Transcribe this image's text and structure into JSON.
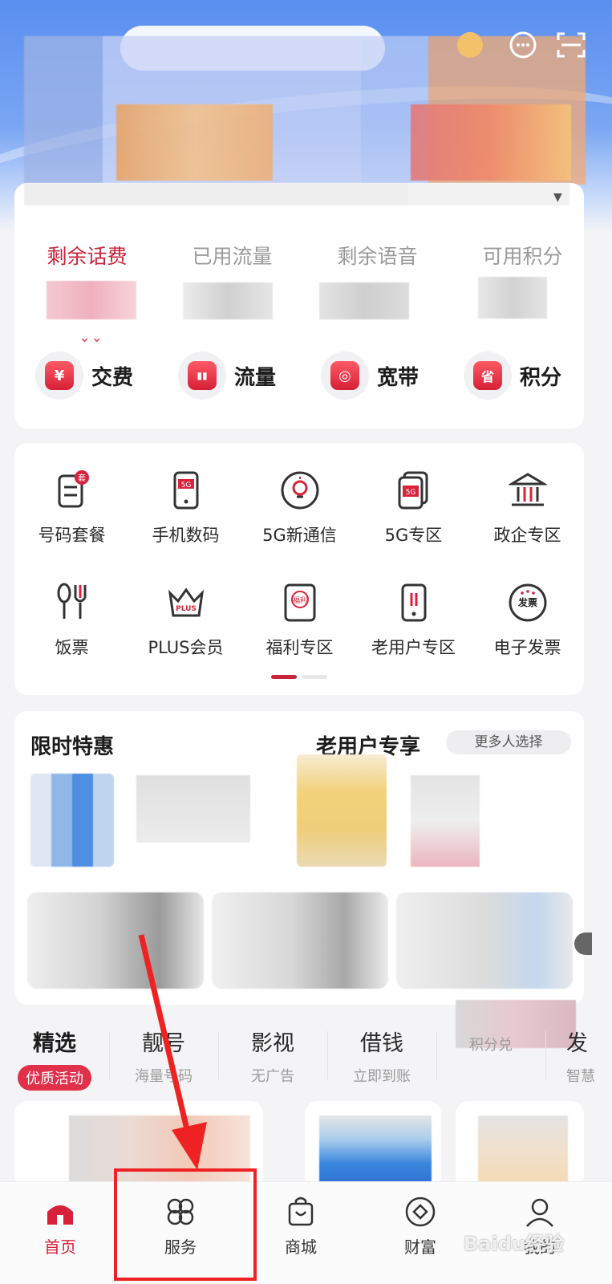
{
  "balance_tabs": [
    {
      "label": "剩余话费",
      "active": true
    },
    {
      "label": "已用流量",
      "active": false
    },
    {
      "label": "剩余语音",
      "active": false
    },
    {
      "label": "可用积分",
      "active": false
    }
  ],
  "quick_actions": [
    {
      "label": "交费",
      "icon": "yuan-icon",
      "glyph": "¥"
    },
    {
      "label": "流量",
      "icon": "bar-chart-icon",
      "glyph": "▮▮"
    },
    {
      "label": "宽带",
      "icon": "router-icon",
      "glyph": "◎"
    },
    {
      "label": "积分",
      "icon": "coupon-icon",
      "glyph": "省"
    }
  ],
  "service_grid": [
    {
      "label": "号码套餐",
      "icon": "sim-plan-icon",
      "badge": "套"
    },
    {
      "label": "手机数码",
      "icon": "phone-5g-icon",
      "badge": "5G"
    },
    {
      "label": "5G新通信",
      "icon": "lightbulb-icon"
    },
    {
      "label": "5G专区",
      "icon": "5g-cards-icon",
      "badge": "5G"
    },
    {
      "label": "政企专区",
      "icon": "building-icon"
    },
    {
      "label": "饭票",
      "icon": "spoon-fork-icon"
    },
    {
      "label": "PLUS会员",
      "icon": "crown-icon",
      "badge": "PLUS"
    },
    {
      "label": "福利专区",
      "icon": "gift-card-icon",
      "badge": "福利"
    },
    {
      "label": "老用户专区",
      "icon": "phone-transfer-icon"
    },
    {
      "label": "电子发票",
      "icon": "invoice-icon",
      "badge": "发票"
    }
  ],
  "promo": {
    "limited_title": "限时特惠",
    "old_user_title": "老用户专享",
    "more_choice": "更多人选择"
  },
  "categories": [
    {
      "title": "精选",
      "sub": "优质活动"
    },
    {
      "title": "靓号",
      "sub": "海量号码"
    },
    {
      "title": "影视",
      "sub": "无广告"
    },
    {
      "title": "借钱",
      "sub": "立即到账"
    },
    {
      "title": "",
      "sub": "积分兑"
    },
    {
      "title": "发",
      "sub": "智慧"
    }
  ],
  "bottom_nav": [
    {
      "label": "首页",
      "icon": "home-icon",
      "active": true
    },
    {
      "label": "服务",
      "icon": "four-petal-icon",
      "active": false
    },
    {
      "label": "商城",
      "icon": "shopping-bag-icon",
      "active": false
    },
    {
      "label": "财富",
      "icon": "diamond-icon",
      "active": false
    },
    {
      "label": "我的",
      "icon": "person-icon",
      "active": false
    }
  ],
  "colors": {
    "accent": "#c8233a",
    "highlight": "#ee2222",
    "header_blue": "#5a8ff0"
  },
  "watermark": "Baidu经验"
}
